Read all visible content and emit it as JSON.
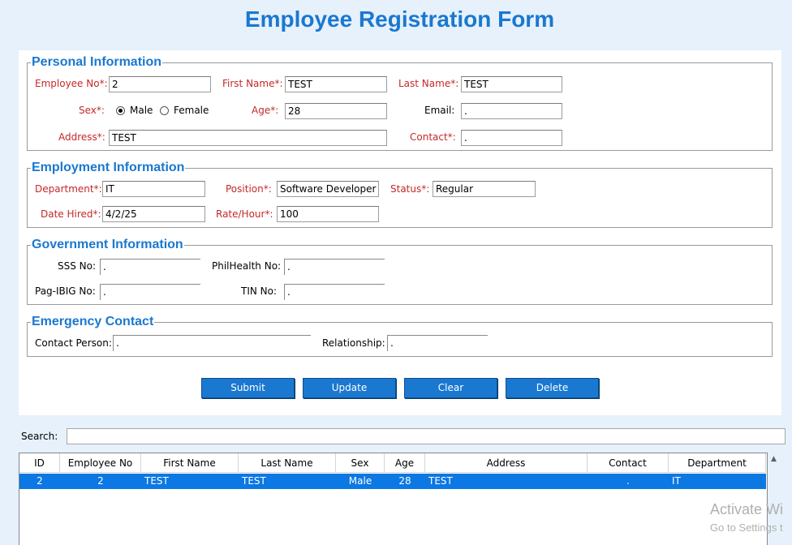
{
  "title": "Employee Registration Form",
  "personal": {
    "legend": "Personal Information",
    "employee_no_label": "Employee No*:",
    "employee_no": "2",
    "first_name_label": "First Name*:",
    "first_name": "TEST",
    "last_name_label": "Last Name*:",
    "last_name": "TEST",
    "sex_label": "Sex*:",
    "male_label": "Male",
    "female_label": "Female",
    "sex_selected": "Male",
    "age_label": "Age*:",
    "age": "28",
    "email_label": "Email:",
    "email": ".",
    "address_label": "Address*:",
    "address": "TEST",
    "contact_label": "Contact*:",
    "contact": "."
  },
  "employment": {
    "legend": "Employment Information",
    "department_label": "Department*:",
    "department": "IT",
    "position_label": "Position*:",
    "position": "Software Developer",
    "status_label": "Status*:",
    "status": "Regular",
    "date_hired_label": "Date Hired*:",
    "date_hired": "4/2/25",
    "rate_label": "Rate/Hour*:",
    "rate": "100"
  },
  "government": {
    "legend": "Government Information",
    "sss_label": "SSS No:",
    "sss": ".",
    "philhealth_label": "PhilHealth No:",
    "philhealth": ".",
    "pagibig_label": "Pag-IBIG No:",
    "pagibig": ".",
    "tin_label": "TIN No:",
    "tin": "."
  },
  "emergency": {
    "legend": "Emergency Contact",
    "person_label": "Contact Person:",
    "person": ".",
    "relationship_label": "Relationship:",
    "relationship": "."
  },
  "buttons": {
    "submit": "Submit",
    "update": "Update",
    "clear": "Clear",
    "delete": "Delete"
  },
  "search": {
    "label": "Search:",
    "value": ""
  },
  "table": {
    "columns": [
      "ID",
      "Employee No",
      "First Name",
      "Last Name",
      "Sex",
      "Age",
      "Address",
      "Contact",
      "Department"
    ],
    "rows": [
      [
        "2",
        "2",
        "TEST",
        "TEST",
        "Male",
        "28",
        "TEST",
        ".",
        "IT"
      ]
    ],
    "selected_row_color": "#0b78e3"
  },
  "watermark": {
    "line1": "Activate Wi",
    "line2": "Go to Settings t"
  },
  "colors": {
    "accent": "#1a78d0",
    "required": "#c62828",
    "background": "#e6f1fb"
  }
}
